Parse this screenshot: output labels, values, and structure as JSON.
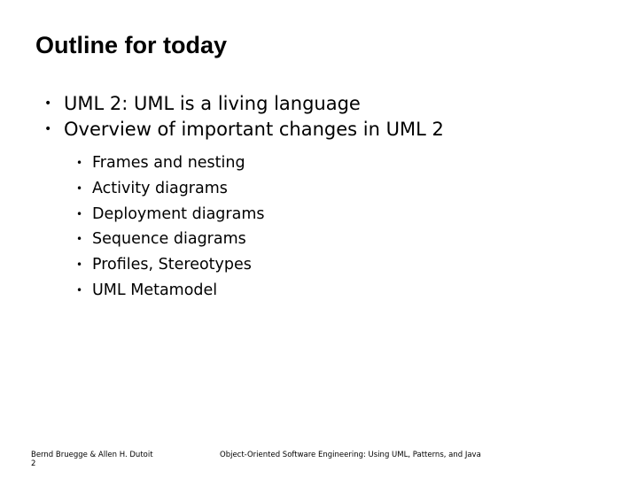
{
  "slide": {
    "title": "Outline for today",
    "bullets": [
      {
        "text": "UML 2: UML is a living language"
      },
      {
        "text": "Overview of important changes in UML 2"
      }
    ],
    "sub_bullets": [
      {
        "text": "Frames and nesting"
      },
      {
        "text": "Activity diagrams"
      },
      {
        "text": "Deployment diagrams"
      },
      {
        "text": "Sequence diagrams"
      },
      {
        "text": "Profiles, Stereotypes"
      },
      {
        "text": "UML Metamodel"
      }
    ],
    "bullet_glyph": "•"
  },
  "footer": {
    "authors": "Bernd Bruegge & Allen H. Dutoit",
    "page_number": "2",
    "book_title": "Object-Oriented Software Engineering: Using UML, Patterns, and Java"
  }
}
